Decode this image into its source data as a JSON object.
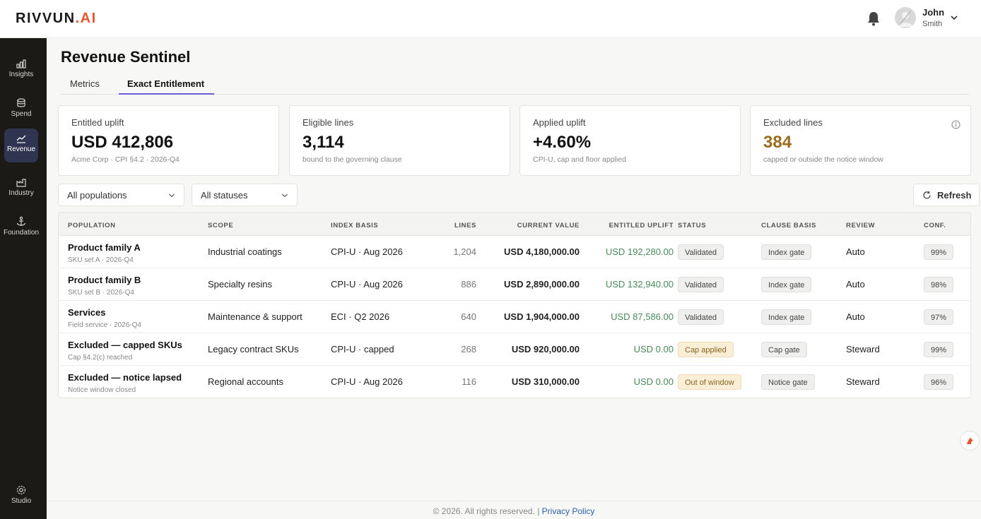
{
  "brand": {
    "name": "RIVVUN",
    "dot": ".",
    "suffix": "AI"
  },
  "user": {
    "first_name": "John",
    "last_name": "Smith"
  },
  "sidebar": {
    "items": [
      {
        "label": "Insights",
        "icon": "bar-chart-icon"
      },
      {
        "label": "Spend",
        "icon": "database-icon"
      },
      {
        "label": "Revenue",
        "icon": "trend-icon",
        "active": true
      },
      {
        "label": "Industry",
        "icon": "factory-icon"
      },
      {
        "label": "Foundation",
        "icon": "anchor-icon"
      }
    ],
    "footer_item": {
      "label": "Studio",
      "icon": "gear-icon"
    }
  },
  "page": {
    "title": "Revenue Sentinel"
  },
  "tabs": [
    {
      "label": "Metrics"
    },
    {
      "label": "Exact Entitlement",
      "active": true
    }
  ],
  "cards": [
    {
      "label": "Entitled uplift",
      "value": "USD 412,806",
      "sub": "Acme Corp · CPI §4.2 · 2026-Q4"
    },
    {
      "label": "Eligible lines",
      "value": "3,114",
      "sub": "bound to the governing clause"
    },
    {
      "label": "Applied uplift",
      "value": "+4.60%",
      "sub": "CPI-U, cap and floor applied"
    },
    {
      "label": "Excluded lines",
      "value": "384",
      "sub": "capped or outside the notice window",
      "value_color": "#9a6c1f"
    }
  ],
  "filters": {
    "population": "All populations",
    "status": "All statuses",
    "refresh_label": "Refresh"
  },
  "table": {
    "headers": {
      "population": "POPULATION",
      "scope": "SCOPE",
      "index_basis": "INDEX BASIS",
      "lines": "LINES",
      "current_value": "CURRENT VALUE",
      "entitled_uplift": "ENTITLED UPLIFT",
      "status": "STATUS",
      "clause_basis": "CLAUSE BASIS",
      "review": "REVIEW",
      "conf": "CONF."
    },
    "rows": [
      {
        "name": "Product family A",
        "sub": "SKU set A · 2026-Q4",
        "scope": "Industrial coatings",
        "index": "CPI-U · Aug 2026",
        "lines": "1,204",
        "current": "USD 4,180,000.00",
        "uplift": "USD 192,280.00",
        "status": "Validated",
        "clause": "Index gate",
        "review": "Auto",
        "conf": "99%"
      },
      {
        "name": "Product family B",
        "sub": "SKU set B · 2026-Q4",
        "scope": "Specialty resins",
        "index": "CPI-U · Aug 2026",
        "lines": "886",
        "current": "USD 2,890,000.00",
        "uplift": "USD 132,940.00",
        "status": "Validated",
        "clause": "Index gate",
        "review": "Auto",
        "conf": "98%"
      },
      {
        "name": "Services",
        "sub": "Field service · 2026-Q4",
        "scope": "Maintenance & support",
        "index": "ECI · Q2 2026",
        "lines": "640",
        "current": "USD 1,904,000.00",
        "uplift": "USD 87,586.00",
        "status": "Validated",
        "clause": "Index gate",
        "review": "Auto",
        "conf": "97%"
      },
      {
        "name": "Excluded — capped SKUs",
        "sub": "Cap §4.2(c) reached",
        "scope": "Legacy contract SKUs",
        "index": "CPI-U · capped",
        "lines": "268",
        "current": "USD 920,000.00",
        "uplift": "USD 0.00",
        "status": "Cap applied",
        "clause": "Cap gate",
        "review": "Steward",
        "conf": "99%"
      },
      {
        "name": "Excluded — notice lapsed",
        "sub": "Notice window closed",
        "scope": "Regional accounts",
        "index": "CPI-U · Aug 2026",
        "lines": "116",
        "current": "USD 310,000.00",
        "uplift": "USD 0.00",
        "status": "Out of window",
        "clause": "Notice gate",
        "review": "Steward",
        "conf": "96%"
      }
    ]
  },
  "footer": {
    "copyright": "© 2026. All rights reserved. |",
    "link": "Privacy Policy"
  },
  "colors": {
    "accent": "#6b5fd8",
    "sidebar_bg": "#1b1a17",
    "active_nav": "#2f3550",
    "positive": "#4a8a5a",
    "warning": "#9a6c1f",
    "brand_ai": "#e4572e"
  }
}
